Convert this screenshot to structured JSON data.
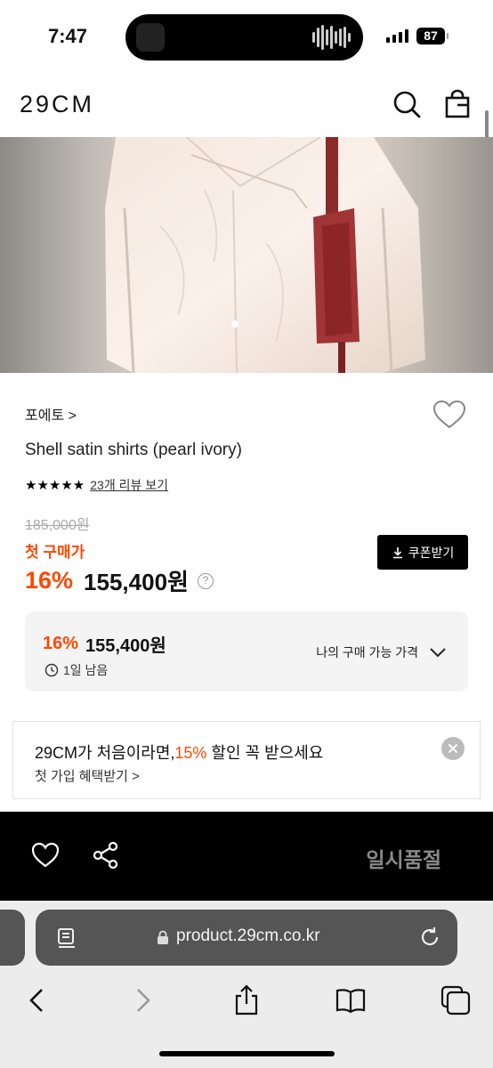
{
  "status_bar": {
    "time": "7:47",
    "battery": "87"
  },
  "header": {
    "logo": "29CM",
    "icons": [
      "search-icon",
      "shopping-bag-icon"
    ]
  },
  "product": {
    "brand": "포에토",
    "brand_chevron": ">",
    "title": "Shell satin shirts (pearl ivory)",
    "stars": "★★★★★",
    "rating": 5,
    "review_link": "23개 리뷰 보기",
    "original_price": "185,000원",
    "first_purchase_label": "첫 구매가",
    "discount": "16%",
    "price": "155,400원",
    "help": "?",
    "coupon_button": "쿠폰받기"
  },
  "price_box": {
    "discount": "16%",
    "price": "155,400원",
    "remaining": "1일 남음",
    "toggle_label": "나의 구매 가능 가격"
  },
  "banner": {
    "title_before": "29CM가 처음이라면,",
    "title_highlight": "15%",
    "title_after": " 할인 꼭 받으세요",
    "subtitle": "첫 가입 혜택받기",
    "subtitle_chevron": ">"
  },
  "action_bar": {
    "soldout_label": "일시품절"
  },
  "browser": {
    "url": "product.29cm.co.kr"
  },
  "colors": {
    "accent": "#ff4800",
    "action_bar": "#000000",
    "soldout_text": "#8a8a8a"
  }
}
